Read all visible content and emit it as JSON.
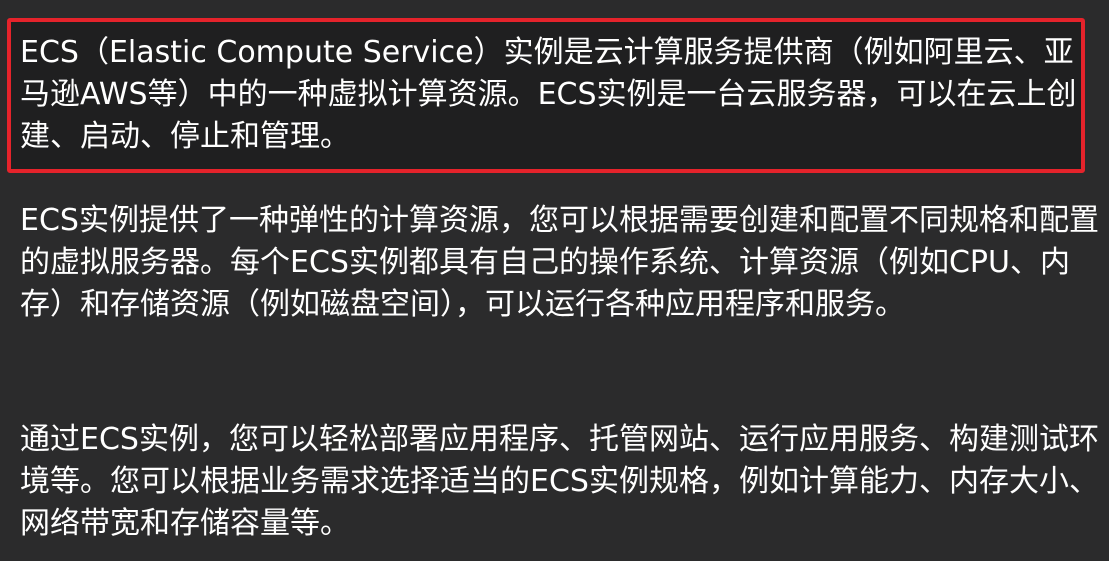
{
  "paragraphs": {
    "p1": "ECS（Elastic Compute Service）实例是云计算服务提供商（例如阿里云、亚马逊AWS等）中的一种虚拟计算资源。ECS实例是一台云服务器，可以在云上创建、启动、停止和管理。",
    "p2": "ECS实例提供了一种弹性的计算资源，您可以根据需要创建和配置不同规格和配置的虚拟服务器。每个ECS实例都具有自己的操作系统、计算资源（例如CPU、内存）和存储资源（例如磁盘空间），可以运行各种应用程序和服务。",
    "p3": "通过ECS实例，您可以轻松部署应用程序、托管网站、运行应用服务、构建测试环境等。您可以根据业务需求选择适当的ECS实例规格，例如计算能力、内存大小、网络带宽和存储容量等。"
  },
  "colors": {
    "background": "#2b2b2c",
    "highlight_border": "#e5232b",
    "highlight_fill": "#1f1f20",
    "text": "#ffffff"
  }
}
